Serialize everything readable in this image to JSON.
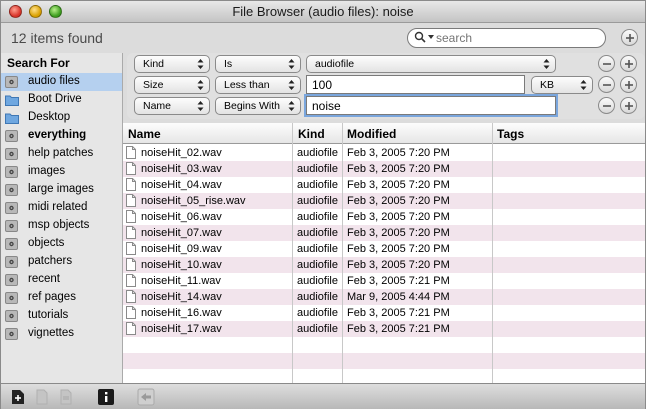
{
  "window": {
    "title": "File Browser (audio files): noise"
  },
  "toolbar": {
    "items_found": "12 items found",
    "search_placeholder": "search"
  },
  "sidebar": {
    "heading": "Search For",
    "items": [
      {
        "label": "audio files",
        "icon": "gear-icon",
        "selected": true,
        "bold": false
      },
      {
        "label": "Boot Drive",
        "icon": "folder-icon",
        "selected": false,
        "bold": false
      },
      {
        "label": "Desktop",
        "icon": "folder-icon",
        "selected": false,
        "bold": false
      },
      {
        "label": "everything",
        "icon": "gear-icon",
        "selected": false,
        "bold": true
      },
      {
        "label": "help patches",
        "icon": "gear-icon",
        "selected": false,
        "bold": false
      },
      {
        "label": "images",
        "icon": "gear-icon",
        "selected": false,
        "bold": false
      },
      {
        "label": "large images",
        "icon": "gear-icon",
        "selected": false,
        "bold": false
      },
      {
        "label": "midi related",
        "icon": "gear-icon",
        "selected": false,
        "bold": false
      },
      {
        "label": "msp objects",
        "icon": "gear-icon",
        "selected": false,
        "bold": false
      },
      {
        "label": "objects",
        "icon": "gear-icon",
        "selected": false,
        "bold": false
      },
      {
        "label": "patchers",
        "icon": "gear-icon",
        "selected": false,
        "bold": false
      },
      {
        "label": "recent",
        "icon": "gear-icon",
        "selected": false,
        "bold": false
      },
      {
        "label": "ref pages",
        "icon": "gear-icon",
        "selected": false,
        "bold": false
      },
      {
        "label": "tutorials",
        "icon": "gear-icon",
        "selected": false,
        "bold": false
      },
      {
        "label": "vignettes",
        "icon": "gear-icon",
        "selected": false,
        "bold": false
      }
    ]
  },
  "filters": [
    {
      "attribute": "Kind",
      "operator": "Is",
      "value": "audiofile",
      "value_type": "popup",
      "unit": ""
    },
    {
      "attribute": "Size",
      "operator": "Less than",
      "value": "100",
      "value_type": "field",
      "unit": "KB"
    },
    {
      "attribute": "Name",
      "operator": "Begins With",
      "value": "noise",
      "value_type": "field",
      "unit": ""
    }
  ],
  "table": {
    "columns": [
      "Name",
      "Kind",
      "Modified",
      "Tags"
    ],
    "rows": [
      {
        "name": "noiseHit_02.wav",
        "kind": "audiofile",
        "modified": "Feb 3, 2005 7:20 PM",
        "tags": ""
      },
      {
        "name": "noiseHit_03.wav",
        "kind": "audiofile",
        "modified": "Feb 3, 2005 7:20 PM",
        "tags": ""
      },
      {
        "name": "noiseHit_04.wav",
        "kind": "audiofile",
        "modified": "Feb 3, 2005 7:20 PM",
        "tags": ""
      },
      {
        "name": "noiseHit_05_rise.wav",
        "kind": "audiofile",
        "modified": "Feb 3, 2005 7:20 PM",
        "tags": ""
      },
      {
        "name": "noiseHit_06.wav",
        "kind": "audiofile",
        "modified": "Feb 3, 2005 7:20 PM",
        "tags": ""
      },
      {
        "name": "noiseHit_07.wav",
        "kind": "audiofile",
        "modified": "Feb 3, 2005 7:20 PM",
        "tags": ""
      },
      {
        "name": "noiseHit_09.wav",
        "kind": "audiofile",
        "modified": "Feb 3, 2005 7:20 PM",
        "tags": ""
      },
      {
        "name": "noiseHit_10.wav",
        "kind": "audiofile",
        "modified": "Feb 3, 2005 7:20 PM",
        "tags": ""
      },
      {
        "name": "noiseHit_11.wav",
        "kind": "audiofile",
        "modified": "Feb 3, 2005 7:21 PM",
        "tags": ""
      },
      {
        "name": "noiseHit_14.wav",
        "kind": "audiofile",
        "modified": "Mar 9, 2005 4:44 PM",
        "tags": ""
      },
      {
        "name": "noiseHit_16.wav",
        "kind": "audiofile",
        "modified": "Feb 3, 2005 7:21 PM",
        "tags": ""
      },
      {
        "name": "noiseHit_17.wav",
        "kind": "audiofile",
        "modified": "Feb 3, 2005 7:21 PM",
        "tags": ""
      }
    ],
    "empty_rows": 3
  },
  "colors": {
    "selection": "#b5d0ef",
    "alt_row": "#f2e4ec",
    "focus_ring": "#7aa6dd"
  },
  "bottombar": {
    "buttons": [
      "new-file-icon",
      "document-icon",
      "document-alt-icon",
      "info-icon",
      "back-arrow-icon"
    ]
  }
}
